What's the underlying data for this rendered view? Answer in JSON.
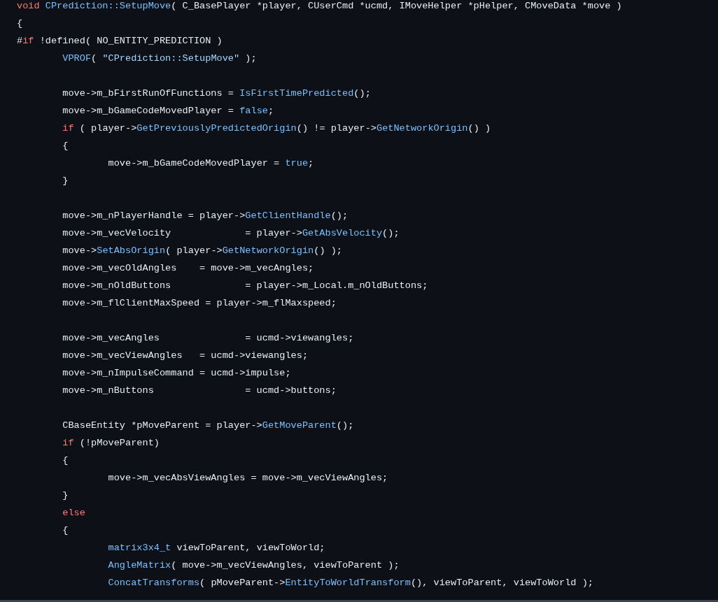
{
  "code": {
    "lines": [
      {
        "kind": "code",
        "tokens": [
          {
            "kind": "keyword",
            "text": "void "
          },
          {
            "kind": "function",
            "text": "CPrediction::SetupMove"
          },
          {
            "kind": "plain",
            "text": "( C_BasePlayer *player, CUserCmd *ucmd, IMoveHelper *pHelper, CMoveData *move )"
          }
        ]
      },
      {
        "kind": "code",
        "tokens": [
          {
            "kind": "plain",
            "text": "{"
          }
        ]
      },
      {
        "kind": "code",
        "tokens": [
          {
            "kind": "plain",
            "text": "#"
          },
          {
            "kind": "keyword",
            "text": "if"
          },
          {
            "kind": "plain",
            "text": " !defined( NO_ENTITY_PREDICTION )"
          }
        ]
      },
      {
        "kind": "code",
        "tokens": [
          {
            "kind": "function",
            "text": "\tVPROF"
          },
          {
            "kind": "plain",
            "text": "( "
          },
          {
            "kind": "string",
            "text": "\"CPrediction::SetupMove\""
          },
          {
            "kind": "plain",
            "text": " );"
          }
        ]
      },
      {
        "kind": "blank"
      },
      {
        "kind": "code",
        "tokens": [
          {
            "kind": "plain",
            "text": "\tmove->m_bFirstRunOfFunctions = "
          },
          {
            "kind": "function",
            "text": "IsFirstTimePredicted"
          },
          {
            "kind": "plain",
            "text": "();"
          }
        ]
      },
      {
        "kind": "code",
        "tokens": [
          {
            "kind": "plain",
            "text": "\tmove->m_bGameCodeMovedPlayer = "
          },
          {
            "kind": "literal",
            "text": "false"
          },
          {
            "kind": "plain",
            "text": ";"
          }
        ]
      },
      {
        "kind": "code",
        "tokens": [
          {
            "kind": "keyword",
            "text": "\tif"
          },
          {
            "kind": "plain",
            "text": " ( player->"
          },
          {
            "kind": "function",
            "text": "GetPreviouslyPredictedOrigin"
          },
          {
            "kind": "plain",
            "text": "() != player->"
          },
          {
            "kind": "function",
            "text": "GetNetworkOrigin"
          },
          {
            "kind": "plain",
            "text": "() )"
          }
        ]
      },
      {
        "kind": "code",
        "tokens": [
          {
            "kind": "plain",
            "text": "\t{"
          }
        ]
      },
      {
        "kind": "code",
        "tokens": [
          {
            "kind": "plain",
            "text": "\t\tmove->m_bGameCodeMovedPlayer = "
          },
          {
            "kind": "literal",
            "text": "true"
          },
          {
            "kind": "plain",
            "text": ";"
          }
        ]
      },
      {
        "kind": "code",
        "tokens": [
          {
            "kind": "plain",
            "text": "\t}"
          }
        ]
      },
      {
        "kind": "blank"
      },
      {
        "kind": "code",
        "tokens": [
          {
            "kind": "plain",
            "text": "\tmove->m_nPlayerHandle = player->"
          },
          {
            "kind": "function",
            "text": "GetClientHandle"
          },
          {
            "kind": "plain",
            "text": "();"
          }
        ]
      },
      {
        "kind": "code",
        "tokens": [
          {
            "kind": "plain",
            "text": "\tmove->m_vecVelocity             = player->"
          },
          {
            "kind": "function",
            "text": "GetAbsVelocity"
          },
          {
            "kind": "plain",
            "text": "();"
          }
        ]
      },
      {
        "kind": "code",
        "tokens": [
          {
            "kind": "plain",
            "text": "\tmove->"
          },
          {
            "kind": "function",
            "text": "SetAbsOrigin"
          },
          {
            "kind": "plain",
            "text": "( player->"
          },
          {
            "kind": "function",
            "text": "GetNetworkOrigin"
          },
          {
            "kind": "plain",
            "text": "() );"
          }
        ]
      },
      {
        "kind": "code",
        "tokens": [
          {
            "kind": "plain",
            "text": "\tmove->m_vecOldAngles    = move->m_vecAngles;"
          }
        ]
      },
      {
        "kind": "code",
        "tokens": [
          {
            "kind": "plain",
            "text": "\tmove->m_nOldButtons             = player->m_Local.m_nOldButtons;"
          }
        ]
      },
      {
        "kind": "code",
        "tokens": [
          {
            "kind": "plain",
            "text": "\tmove->m_flClientMaxSpeed = player->m_flMaxspeed;"
          }
        ]
      },
      {
        "kind": "blank"
      },
      {
        "kind": "code",
        "tokens": [
          {
            "kind": "plain",
            "text": "\tmove->m_vecAngles               = ucmd->viewangles;"
          }
        ]
      },
      {
        "kind": "code",
        "tokens": [
          {
            "kind": "plain",
            "text": "\tmove->m_vecViewAngles   = ucmd->viewangles;"
          }
        ]
      },
      {
        "kind": "code",
        "tokens": [
          {
            "kind": "plain",
            "text": "\tmove->m_nImpulseCommand = ucmd->impulse;"
          }
        ]
      },
      {
        "kind": "code",
        "tokens": [
          {
            "kind": "plain",
            "text": "\tmove->m_nButtons                = ucmd->buttons;"
          }
        ]
      },
      {
        "kind": "blank"
      },
      {
        "kind": "code",
        "tokens": [
          {
            "kind": "plain",
            "text": "\tCBaseEntity *pMoveParent = player->"
          },
          {
            "kind": "function",
            "text": "GetMoveParent"
          },
          {
            "kind": "plain",
            "text": "();"
          }
        ]
      },
      {
        "kind": "code",
        "tokens": [
          {
            "kind": "keyword",
            "text": "\tif"
          },
          {
            "kind": "plain",
            "text": " (!pMoveParent)"
          }
        ]
      },
      {
        "kind": "code",
        "tokens": [
          {
            "kind": "plain",
            "text": "\t{"
          }
        ]
      },
      {
        "kind": "code",
        "tokens": [
          {
            "kind": "plain",
            "text": "\t\tmove->m_vecAbsViewAngles = move->m_vecViewAngles;"
          }
        ]
      },
      {
        "kind": "code",
        "tokens": [
          {
            "kind": "plain",
            "text": "\t}"
          }
        ]
      },
      {
        "kind": "code",
        "tokens": [
          {
            "kind": "keyword",
            "text": "\telse"
          }
        ]
      },
      {
        "kind": "code",
        "tokens": [
          {
            "kind": "plain",
            "text": "\t{"
          }
        ]
      },
      {
        "kind": "code",
        "tokens": [
          {
            "kind": "type",
            "text": "\t\tmatrix3x4_t"
          },
          {
            "kind": "plain",
            "text": " viewToParent, viewToWorld;"
          }
        ]
      },
      {
        "kind": "code",
        "tokens": [
          {
            "kind": "function",
            "text": "\t\tAngleMatrix"
          },
          {
            "kind": "plain",
            "text": "( move->m_vecViewAngles, viewToParent );"
          }
        ]
      },
      {
        "kind": "code",
        "tokens": [
          {
            "kind": "function",
            "text": "\t\tConcatTransforms"
          },
          {
            "kind": "plain",
            "text": "( pMoveParent->"
          },
          {
            "kind": "function",
            "text": "EntityToWorldTransform"
          },
          {
            "kind": "plain",
            "text": "(), viewToParent, viewToWorld );"
          }
        ]
      }
    ]
  }
}
